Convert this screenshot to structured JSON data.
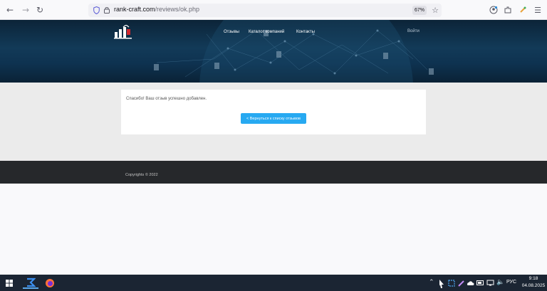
{
  "browser": {
    "url_domain": "rank-craft.com",
    "url_path": "/reviews/ok.php",
    "zoom": "67%",
    "icons": [
      "back-arrow-icon",
      "forward-arrow-icon",
      "reload-icon",
      "shield-icon",
      "lock-icon",
      "star-icon",
      "account-icon",
      "extensions-icon",
      "bookmark-icon",
      "menu-icon"
    ]
  },
  "header": {
    "menu": [
      "Отзывы",
      "Каталог компаний",
      "Контакты"
    ],
    "login": "Войти"
  },
  "main": {
    "message": "Спасибо! Ваш отзыв успешно добавлен.",
    "back_button": "< Вернуться к списку отзывов"
  },
  "footer": {
    "copyright": "Copyrights © 2022"
  },
  "taskbar": {
    "language": "РУС",
    "time": "9:18",
    "date": "04.08.2025",
    "colors": {
      "accent": "#27a9f1",
      "taskbar": "#1b2533"
    }
  }
}
